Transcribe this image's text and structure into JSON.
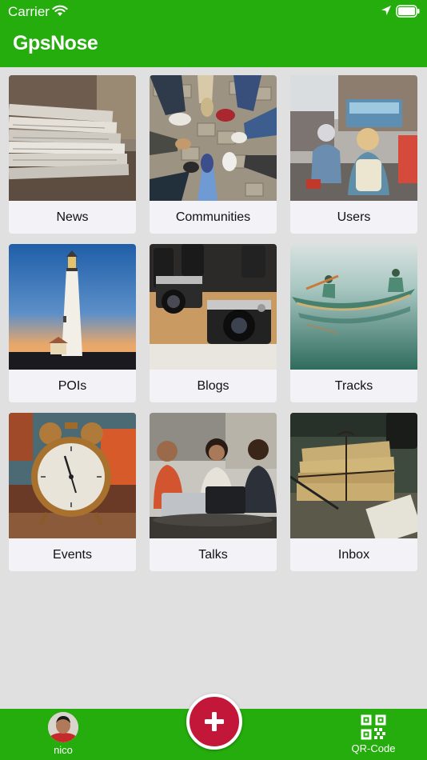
{
  "status_bar": {
    "carrier": "Carrier",
    "icons": [
      "wifi-icon",
      "location-arrow-icon",
      "battery-icon"
    ]
  },
  "header": {
    "title": "GpsNose",
    "color": "#24ad0c"
  },
  "tiles": [
    {
      "label": "News",
      "icon": "newspaper-photo"
    },
    {
      "label": "Communities",
      "icon": "feet-circle-photo"
    },
    {
      "label": "Users",
      "icon": "scooter-street-photo"
    },
    {
      "label": "POIs",
      "icon": "lighthouse-photo"
    },
    {
      "label": "Blogs",
      "icon": "cameras-photo"
    },
    {
      "label": "Tracks",
      "icon": "canoe-photo"
    },
    {
      "label": "Events",
      "icon": "alarm-clock-photo"
    },
    {
      "label": "Talks",
      "icon": "people-laptops-photo"
    },
    {
      "label": "Inbox",
      "icon": "letters-bundle-photo"
    }
  ],
  "bottom_bar": {
    "profile_name": "nico",
    "add_icon": "plus-icon",
    "qr_label": "QR-Code",
    "add_color": "#c3173a"
  }
}
